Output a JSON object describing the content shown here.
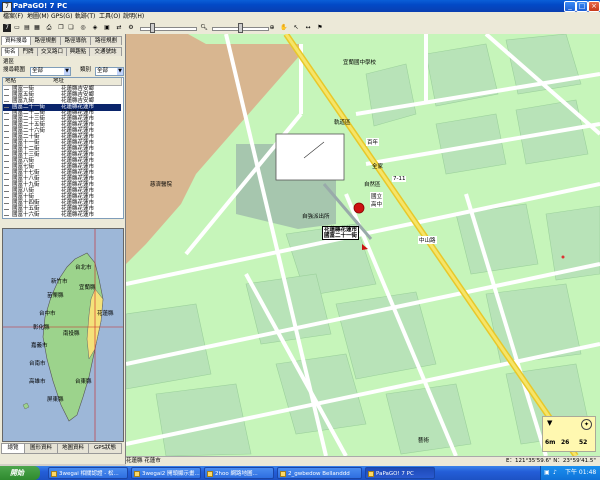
{
  "window": {
    "title": "PaPaGO! 7 PC",
    "app_icon": "7"
  },
  "menu": [
    "檔案(F)",
    "地圖(M)",
    "GPS(G)",
    "軌跡(T)",
    "工具(O)",
    "說明(H)"
  ],
  "left_tabs_top": [
    "資料搜尋",
    "路徑規劃",
    "路徑導航",
    "路徑規劃"
  ],
  "left_tabs_second": [
    "街名",
    "門牌",
    "交叉路口",
    "興趣點",
    "交通號誌"
  ],
  "filter": {
    "section_label": "選區",
    "range_label": "搜尋範圍",
    "range_value": "全部",
    "category_label": "類別",
    "category_value": "全部"
  },
  "list": {
    "headers": [
      "地點",
      "地址"
    ],
    "rows": [
      {
        "name": "國富一街",
        "addr": "花蓮縣吉安鄉",
        "selected": false
      },
      {
        "name": "國富五街",
        "addr": "花蓮縣吉安鄉",
        "selected": false
      },
      {
        "name": "國富九街",
        "addr": "花蓮縣吉安鄉",
        "selected": false
      },
      {
        "name": "國富二十一街",
        "addr": "花蓮縣花蓮市",
        "selected": true
      },
      {
        "name": "國富二十二街",
        "addr": "花蓮縣花蓮市",
        "selected": false
      },
      {
        "name": "國富二十三街",
        "addr": "花蓮縣花蓮市",
        "selected": false
      },
      {
        "name": "國富二十五街",
        "addr": "花蓮縣花蓮市",
        "selected": false
      },
      {
        "name": "國富二十六街",
        "addr": "花蓮縣花蓮市",
        "selected": false
      },
      {
        "name": "國富二十街",
        "addr": "花蓮縣花蓮市",
        "selected": false
      },
      {
        "name": "國富十一街",
        "addr": "花蓮縣花蓮市",
        "selected": false
      },
      {
        "name": "國富十二街",
        "addr": "花蓮縣花蓮市",
        "selected": false
      },
      {
        "name": "國富十三街",
        "addr": "花蓮縣花蓮市",
        "selected": false
      },
      {
        "name": "國富六街",
        "addr": "花蓮縣花蓮市",
        "selected": false
      },
      {
        "name": "國富七街",
        "addr": "花蓮縣花蓮市",
        "selected": false
      },
      {
        "name": "國富十七街",
        "addr": "花蓮縣花蓮市",
        "selected": false
      },
      {
        "name": "國富十八街",
        "addr": "花蓮縣花蓮市",
        "selected": false
      },
      {
        "name": "國富十九街",
        "addr": "花蓮縣花蓮市",
        "selected": false
      },
      {
        "name": "國富八街",
        "addr": "花蓮縣花蓮市",
        "selected": false
      },
      {
        "name": "國富十街",
        "addr": "花蓮縣花蓮市",
        "selected": false
      },
      {
        "name": "國富十四街",
        "addr": "花蓮縣花蓮市",
        "selected": false
      },
      {
        "name": "國富十五街",
        "addr": "花蓮縣花蓮市",
        "selected": false
      },
      {
        "name": "國富十六街",
        "addr": "花蓮縣花蓮市",
        "selected": false
      }
    ]
  },
  "overview_cities": [
    "台北市",
    "宜蘭縣",
    "新竹市",
    "苗栗縣",
    "台中市",
    "彰化縣",
    "南投縣",
    "花蓮縣",
    "嘉義市",
    "台南市",
    "高雄市",
    "台東縣",
    "屏東縣"
  ],
  "bottom_tabs": [
    "總覽",
    "圖形資料",
    "地圖資料",
    "GPS狀態"
  ],
  "map": {
    "labels": {
      "school": "宜蘭國中學校",
      "hospital": "慈濟醫院",
      "tram": "軌道區",
      "poi1": "百年",
      "poi2": "全家",
      "poi3": "7-11",
      "poi4": "自然區",
      "poi5": "自強派出所",
      "poi6": "國立\n高中",
      "road": "中山路",
      "bottom_poi": "藝術"
    },
    "marker_text_line1": "花蓮縣花蓮市",
    "marker_text_line2": "國富二十一街",
    "nav": {
      "units_left": "6m",
      "number": "26",
      "speed": "52"
    }
  },
  "status": {
    "place": "花蓮縣 花蓮市",
    "coord": "E：121°35'59.6\"  N：23°59'41.5\""
  },
  "taskbar": {
    "start": "開始",
    "tasks": [
      "3wegai 相關認證 - 松...",
      "3wegai2 開頭顯示畫...",
      "2hoo 網路地圖...",
      "2_gwbedow Bellanddd",
      "PaPaGO! 7 PC"
    ],
    "clock": "下午 01:48"
  },
  "colors": {
    "map_bg": "#c6f5ba",
    "block": "#b8e3b8",
    "road": "#ffffff",
    "main_road": "#f2e04a",
    "brown": "#d8b690"
  }
}
